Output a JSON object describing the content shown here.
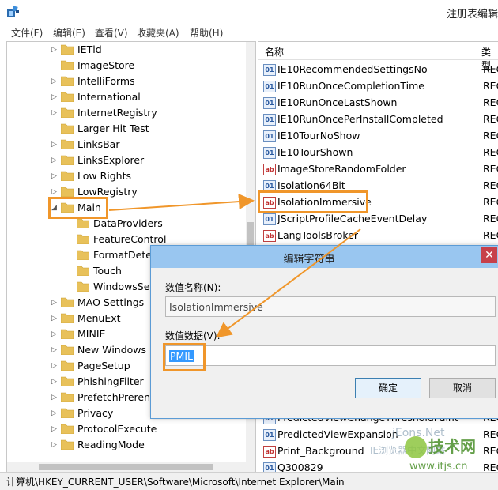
{
  "window": {
    "title": "注册表编辑"
  },
  "menu": [
    "文件(F)",
    "编辑(E)",
    "查看(V)",
    "收藏夹(A)",
    "帮助(H)"
  ],
  "tree": {
    "items": [
      {
        "label": "IETld",
        "exp": "▷",
        "indent": 0
      },
      {
        "label": "ImageStore",
        "exp": "",
        "indent": 0
      },
      {
        "label": "IntelliForms",
        "exp": "▷",
        "indent": 0
      },
      {
        "label": "International",
        "exp": "▷",
        "indent": 0
      },
      {
        "label": "InternetRegistry",
        "exp": "▷",
        "indent": 0
      },
      {
        "label": "Larger Hit Test",
        "exp": "",
        "indent": 0
      },
      {
        "label": "LinksBar",
        "exp": "▷",
        "indent": 0
      },
      {
        "label": "LinksExplorer",
        "exp": "▷",
        "indent": 0
      },
      {
        "label": "Low Rights",
        "exp": "▷",
        "indent": 0
      },
      {
        "label": "LowRegistry",
        "exp": "▷",
        "indent": 0
      },
      {
        "label": "Main",
        "exp": "◢",
        "indent": 0
      },
      {
        "label": "DataProviders",
        "exp": "",
        "indent": 1
      },
      {
        "label": "FeatureControl",
        "exp": "",
        "indent": 1
      },
      {
        "label": "FormatDetection",
        "exp": "",
        "indent": 1
      },
      {
        "label": "Touch",
        "exp": "",
        "indent": 1
      },
      {
        "label": "WindowsSearch",
        "exp": "",
        "indent": 1
      },
      {
        "label": "MAO Settings",
        "exp": "▷",
        "indent": 0
      },
      {
        "label": "MenuExt",
        "exp": "▷",
        "indent": 0
      },
      {
        "label": "MINIE",
        "exp": "▷",
        "indent": 0
      },
      {
        "label": "New Windows",
        "exp": "▷",
        "indent": 0
      },
      {
        "label": "PageSetup",
        "exp": "▷",
        "indent": 0
      },
      {
        "label": "PhishingFilter",
        "exp": "▷",
        "indent": 0
      },
      {
        "label": "PrefetchPrerender",
        "exp": "▷",
        "indent": 0
      },
      {
        "label": "Privacy",
        "exp": "▷",
        "indent": 0
      },
      {
        "label": "ProtocolExecute",
        "exp": "▷",
        "indent": 0
      },
      {
        "label": "ReadingMode",
        "exp": "▷",
        "indent": 0
      }
    ]
  },
  "values": {
    "header": {
      "name": "名称",
      "type": "类型"
    },
    "rows": [
      {
        "name": "IE10RecommendedSettingsNo",
        "kind": "bin",
        "type": "REG"
      },
      {
        "name": "IE10RunOnceCompletionTime",
        "kind": "bin",
        "type": "REG"
      },
      {
        "name": "IE10RunOnceLastShown",
        "kind": "bin",
        "type": "REG"
      },
      {
        "name": "IE10RunOncePerInstallCompleted",
        "kind": "bin",
        "type": "REG"
      },
      {
        "name": "IE10TourNoShow",
        "kind": "bin",
        "type": "REG"
      },
      {
        "name": "IE10TourShown",
        "kind": "bin",
        "type": "REG"
      },
      {
        "name": "ImageStoreRandomFolder",
        "kind": "str",
        "type": "REG"
      },
      {
        "name": "Isolation64Bit",
        "kind": "bin",
        "type": "REG"
      },
      {
        "name": "IsolationImmersive",
        "kind": "str",
        "type": "REG"
      },
      {
        "name": "JScriptProfileCacheEventDelay",
        "kind": "bin",
        "type": "REG"
      },
      {
        "name": "LangToolsBroker",
        "kind": "str",
        "type": "REG"
      }
    ],
    "rows_bottom": [
      {
        "name": "PredictedViewChangeThresholdPaint",
        "kind": "bin",
        "type": "REG"
      },
      {
        "name": "PredictedViewExpansion",
        "kind": "bin",
        "type": "REG"
      },
      {
        "name": "Print_Background",
        "kind": "str",
        "type": "REG"
      },
      {
        "name": "Q300829",
        "kind": "bin",
        "type": "REG"
      }
    ]
  },
  "status": {
    "path": "计算机\\HKEY_CURRENT_USER\\Software\\Microsoft\\Internet Explorer\\Main"
  },
  "dialog": {
    "title": "编辑字符串",
    "name_label": "数值名称(N):",
    "name_value": "IsolationImmersive",
    "data_label": "数值数据(V):",
    "data_value": "PMIL",
    "ok": "确定",
    "cancel": "取消"
  },
  "watermark": {
    "line1": "jEons.Net",
    "line2": "IE浏览器中文网站",
    "brand": "技术网",
    "url": "www.itjs.cn"
  },
  "colors": {
    "highlight": "#f0962a",
    "dialog_title": "#99c6f0",
    "selection": "#3399ff"
  }
}
